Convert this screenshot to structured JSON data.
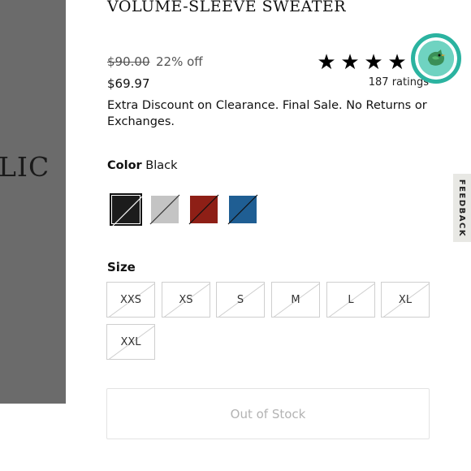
{
  "brand_fragment": "LIC",
  "product": {
    "title": "VOLUME-SLEEVE SWEATER",
    "original_price": "$90.00",
    "discount": "22% off",
    "current_price": "$69.97",
    "rating_stars": 4,
    "ratings_count": "187 ratings",
    "notice": "Extra Discount on Clearance. Final Sale. No Returns or Exchanges."
  },
  "color": {
    "label": "Color",
    "selected": "Black",
    "swatches": [
      {
        "name": "Black",
        "hex": "#1c1c1c",
        "selected": true
      },
      {
        "name": "Light Gray",
        "hex": "#c4c4c4",
        "selected": false
      },
      {
        "name": "Red",
        "hex": "#8e1f16",
        "selected": false
      },
      {
        "name": "Blue",
        "hex": "#1f5e93",
        "selected": false
      }
    ]
  },
  "size": {
    "label": "Size",
    "options": [
      "XXS",
      "XS",
      "S",
      "M",
      "L",
      "XL",
      "XXL"
    ]
  },
  "cta": {
    "label": "Out of Stock"
  },
  "feedback_tab": "FEEDBACK",
  "colors": {
    "chat_teal": "#2bb3a0",
    "left_panel": "#6b6b6b"
  }
}
